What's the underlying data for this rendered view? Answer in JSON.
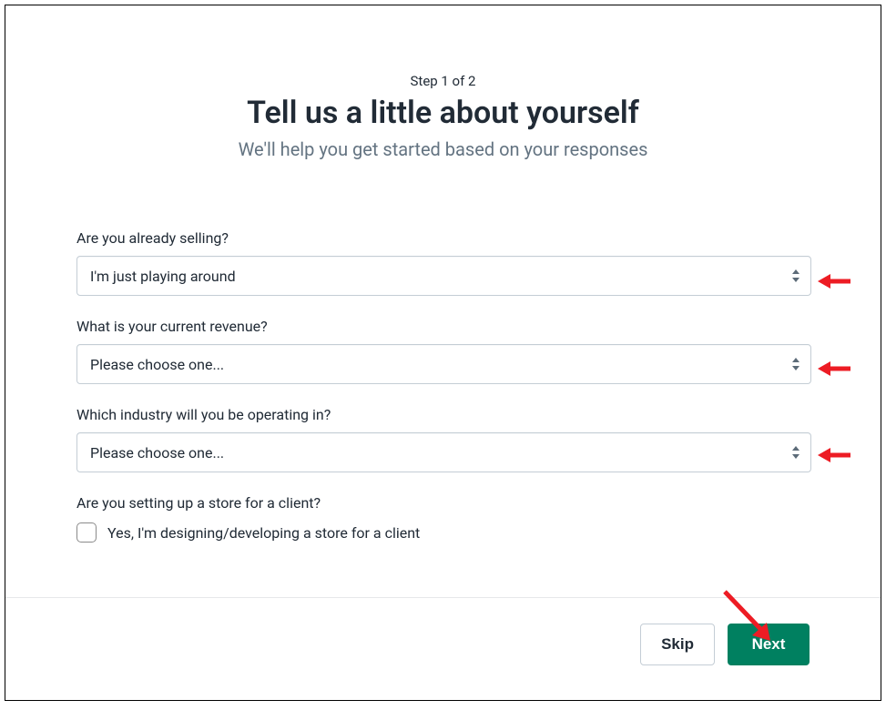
{
  "header": {
    "step": "Step 1 of 2",
    "title": "Tell us a little about yourself",
    "subtitle": "We'll help you get started based on your responses"
  },
  "form": {
    "q1": {
      "label": "Are you already selling?",
      "value": "I'm just playing around"
    },
    "q2": {
      "label": "What is your current revenue?",
      "value": "Please choose one..."
    },
    "q3": {
      "label": "Which industry will you be operating in?",
      "value": "Please choose one..."
    },
    "q4": {
      "label": "Are you setting up a store for a client?",
      "checkbox_label": "Yes, I'm designing/developing a store for a client"
    }
  },
  "footer": {
    "skip": "Skip",
    "next": "Next"
  }
}
